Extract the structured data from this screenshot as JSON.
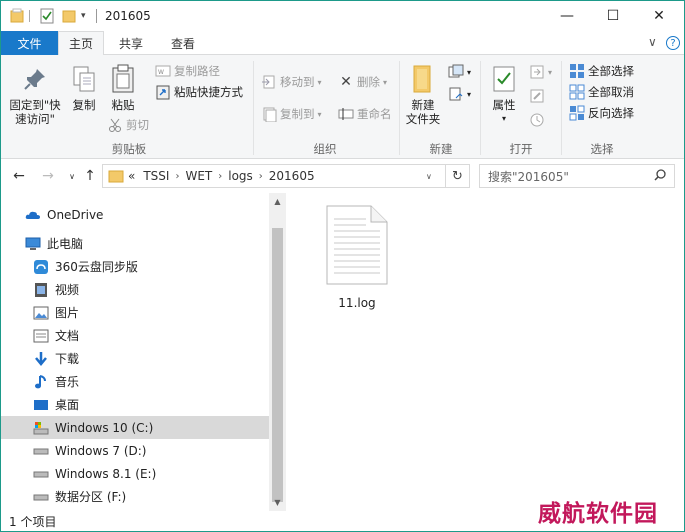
{
  "window": {
    "title": "201605",
    "controls": {
      "minimize": "—",
      "maximize": "☐",
      "close": "✕"
    }
  },
  "tabs": {
    "file": "文件",
    "items": [
      "主页",
      "共享",
      "查看"
    ],
    "active": "主页",
    "collapse_glyph": "∨",
    "help_glyph": "?"
  },
  "ribbon": {
    "clipboard": {
      "pin": "固定到\"快\n速访问\"",
      "pin_line1": "固定到\"快",
      "pin_line2": "速访问\"",
      "copy": "复制",
      "paste": "粘贴",
      "copy_path": "复制路径",
      "paste_shortcut": "粘贴快捷方式",
      "cut": "剪切",
      "label": "剪贴板"
    },
    "organize": {
      "move_to": "移动到",
      "copy_to": "复制到",
      "delete": "删除",
      "rename": "重命名",
      "label": "组织"
    },
    "new": {
      "new_folder_line1": "新建",
      "new_folder_line2": "文件夹",
      "label": "新建"
    },
    "open": {
      "properties": "属性",
      "label": "打开"
    },
    "select": {
      "select_all": "全部选择",
      "select_none": "全部取消",
      "invert": "反向选择",
      "label": "选择"
    }
  },
  "address": {
    "prefix": "«",
    "crumbs": [
      "TSSI",
      "WET",
      "logs",
      "201605"
    ],
    "search_placeholder": "搜索\"201605\""
  },
  "nav": {
    "items": [
      {
        "label": "OneDrive",
        "icon": "onedrive-icon"
      },
      {
        "label": "此电脑",
        "icon": "pc-icon"
      },
      {
        "label": "360云盘同步版",
        "icon": "cloud-sync-icon"
      },
      {
        "label": "视频",
        "icon": "video-icon"
      },
      {
        "label": "图片",
        "icon": "picture-icon"
      },
      {
        "label": "文档",
        "icon": "document-icon"
      },
      {
        "label": "下载",
        "icon": "download-icon"
      },
      {
        "label": "音乐",
        "icon": "music-icon"
      },
      {
        "label": "桌面",
        "icon": "desktop-icon"
      },
      {
        "label": "Windows 10 (C:)",
        "icon": "drive-c-icon",
        "selected": true
      },
      {
        "label": "Windows 7 (D:)",
        "icon": "drive-icon"
      },
      {
        "label": "Windows 8.1 (E:)",
        "icon": "drive-icon"
      },
      {
        "label": "数据分区 (F:)",
        "icon": "drive-icon"
      }
    ]
  },
  "content": {
    "files": [
      {
        "name": "11.log",
        "icon": "text-file-icon"
      }
    ]
  },
  "status": {
    "count": "1 个项目"
  },
  "watermark": "威航软件园",
  "colors": {
    "accent": "#1979ca",
    "border": "#1d9a8a",
    "selected": "#d9d9d9"
  }
}
